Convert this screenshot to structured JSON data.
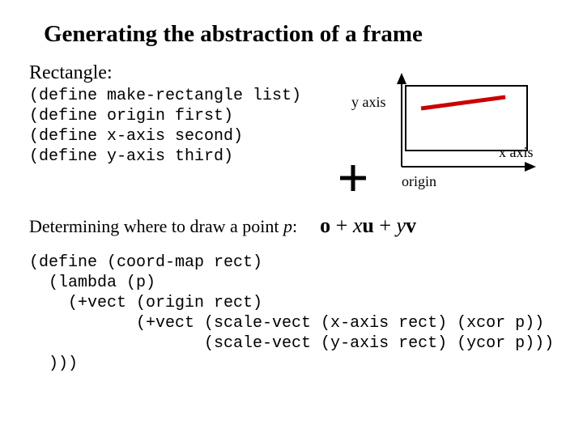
{
  "title": "Generating the abstraction of a frame",
  "subhead": "Rectangle:",
  "code_upper": "(define make-rectangle list)\n(define origin first)\n(define x-axis second)\n(define y-axis third)",
  "diagram": {
    "y_axis_label": "y axis",
    "x_axis_label": "x axis",
    "origin_label": "origin"
  },
  "determine_text": "Determining where to draw a point ",
  "determine_p": "p",
  "determine_colon": ":",
  "formula": {
    "o": "o",
    "plus1": " + ",
    "x": "x",
    "u": "u",
    "plus2": " + ",
    "y": "y",
    "v": "v"
  },
  "code_lower": "(define (coord-map rect)\n  (lambda (p)\n    (+vect (origin rect)\n           (+vect (scale-vect (x-axis rect) (xcor p))\n                  (scale-vect (y-axis rect) (ycor p)))\n  )))"
}
